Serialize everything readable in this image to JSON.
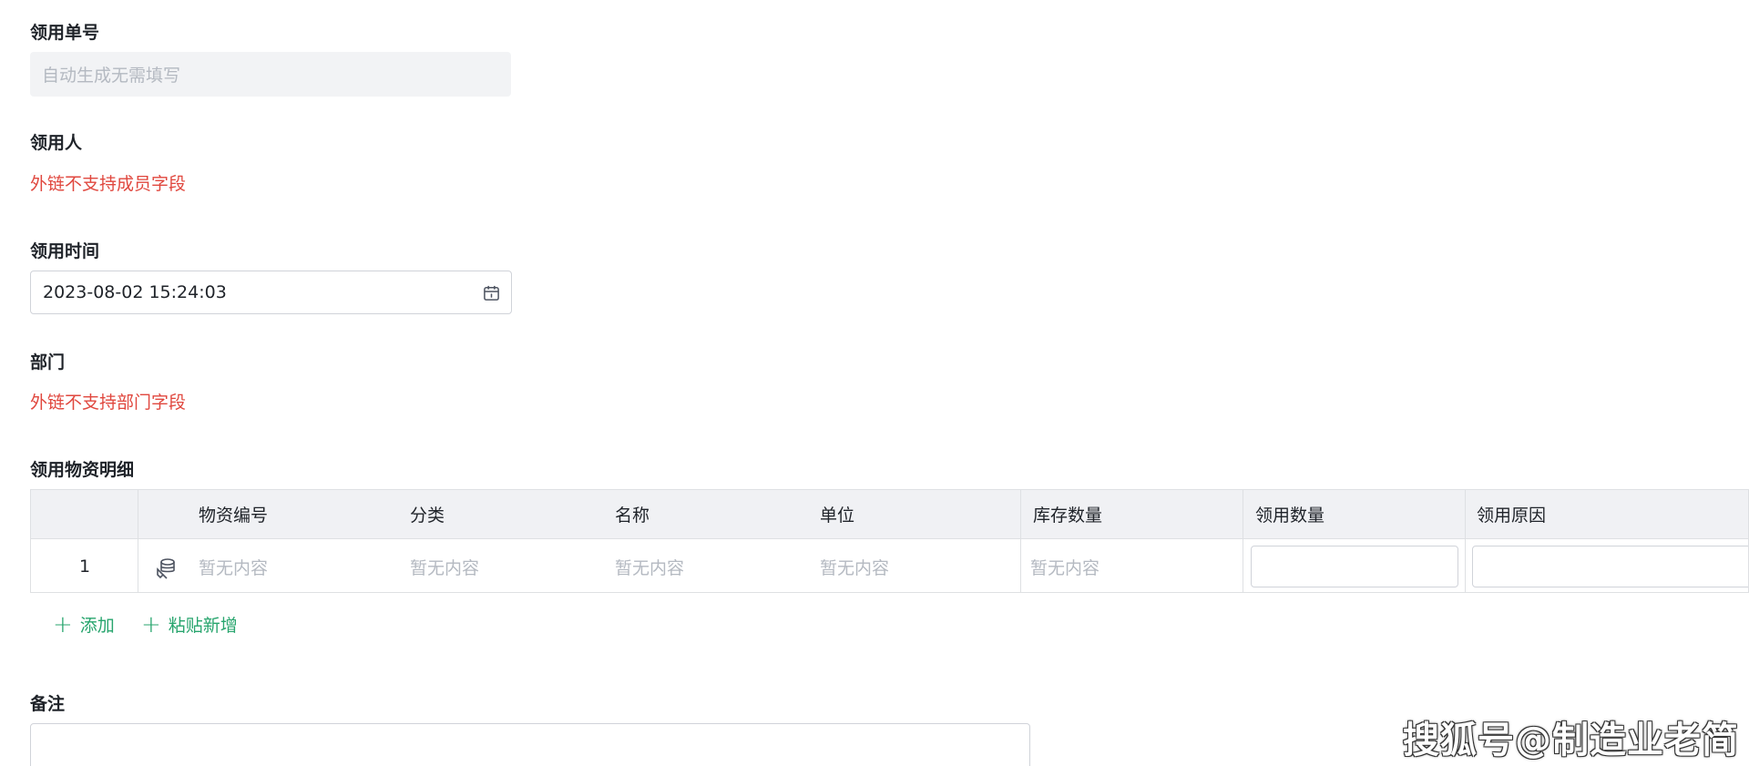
{
  "form": {
    "order_no": {
      "label": "领用单号",
      "placeholder": "自动生成无需填写"
    },
    "recipient": {
      "label": "领用人",
      "notice": "外链不支持成员字段"
    },
    "time": {
      "label": "领用时间",
      "value": "2023-08-02 15:24:03",
      "icon": "calendar-icon"
    },
    "department": {
      "label": "部门",
      "notice": "外链不支持部门字段"
    },
    "details": {
      "label": "领用物资明细",
      "columns": [
        "物资编号",
        "分类",
        "名称",
        "单位",
        "库存数量",
        "领用数量",
        "领用原因"
      ],
      "rows": [
        {
          "index": "1",
          "code": "暂无内容",
          "category": "暂无内容",
          "name": "暂无内容",
          "unit": "暂无内容",
          "stock": "暂无内容"
        }
      ],
      "add_label": "添加",
      "paste_label": "粘贴新增",
      "plus_glyph": "+"
    },
    "remark": {
      "label": "备注"
    }
  },
  "watermark": "搜狐号@制造业老简",
  "colors": {
    "warning": "#e0473e",
    "accent_green": "#28a56e",
    "header_bg": "#f0f1f4",
    "placeholder": "#b4b9c1"
  }
}
